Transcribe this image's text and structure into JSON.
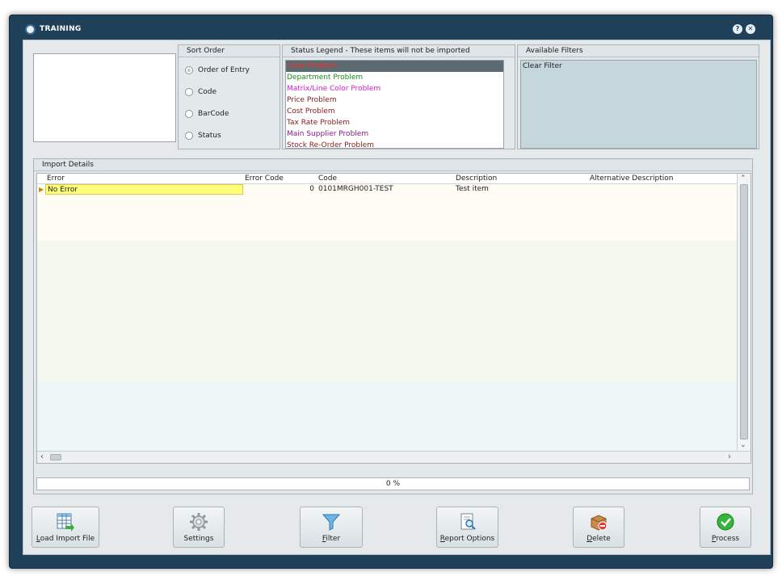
{
  "window": {
    "title": "TRAINING",
    "help_glyph": "?",
    "close_glyph": "✕"
  },
  "sort_order": {
    "header": "Sort Order",
    "options": [
      {
        "label": "Order of Entry",
        "selected": true
      },
      {
        "label": "Code",
        "selected": false
      },
      {
        "label": "BarCode",
        "selected": false
      },
      {
        "label": "Status",
        "selected": false
      }
    ]
  },
  "status_legend": {
    "header": "Status Legend - These items will not be imported",
    "items": [
      {
        "label": "Code Problem",
        "color": "#ff2a2a",
        "selected": true
      },
      {
        "label": "Department Problem",
        "color": "#1a8a1a",
        "selected": false
      },
      {
        "label": "Matrix/Line Color Problem",
        "color": "#d21ad2",
        "selected": false
      },
      {
        "label": "Price Problem",
        "color": "#8a1a1a",
        "selected": false
      },
      {
        "label": "Cost Problem",
        "color": "#8a1a1a",
        "selected": false
      },
      {
        "label": "Tax Rate Problem",
        "color": "#8a1a1a",
        "selected": false
      },
      {
        "label": "Main Supplier Problem",
        "color": "#8a1a8a",
        "selected": false
      },
      {
        "label": "Stock Re-Order Problem",
        "color": "#8a1a1a",
        "selected": false
      }
    ]
  },
  "available_filters": {
    "header": "Available Filters",
    "items": [
      "Clear Filter"
    ]
  },
  "import_details": {
    "header": "Import Details",
    "columns": [
      "Error",
      "Error Code",
      "Code",
      "Description",
      "Alternative Description"
    ],
    "rows": [
      {
        "error": "No Error",
        "error_code": "0",
        "code": "0101MRGH001-TEST",
        "description": "Test item",
        "alt_description": ""
      }
    ],
    "progress_text": "0 %"
  },
  "toolbar": {
    "load_import_file": {
      "label_u": "L",
      "label_rest": "oad Import File"
    },
    "settings": {
      "label": "Settings"
    },
    "filter": {
      "label_u": "F",
      "label_rest": "ilter"
    },
    "report_options": {
      "label_u": "R",
      "label_rest": "eport Options"
    },
    "delete": {
      "label_u": "D",
      "label_rest": "elete"
    },
    "process": {
      "label_u": "P",
      "label_rest": "rocess"
    }
  },
  "colors": {
    "title_bar": "#1f4059",
    "selected_legend_bg": "#5b6b72",
    "error_cell_bg": "#ffff7a",
    "process_green": "#35b53a"
  }
}
